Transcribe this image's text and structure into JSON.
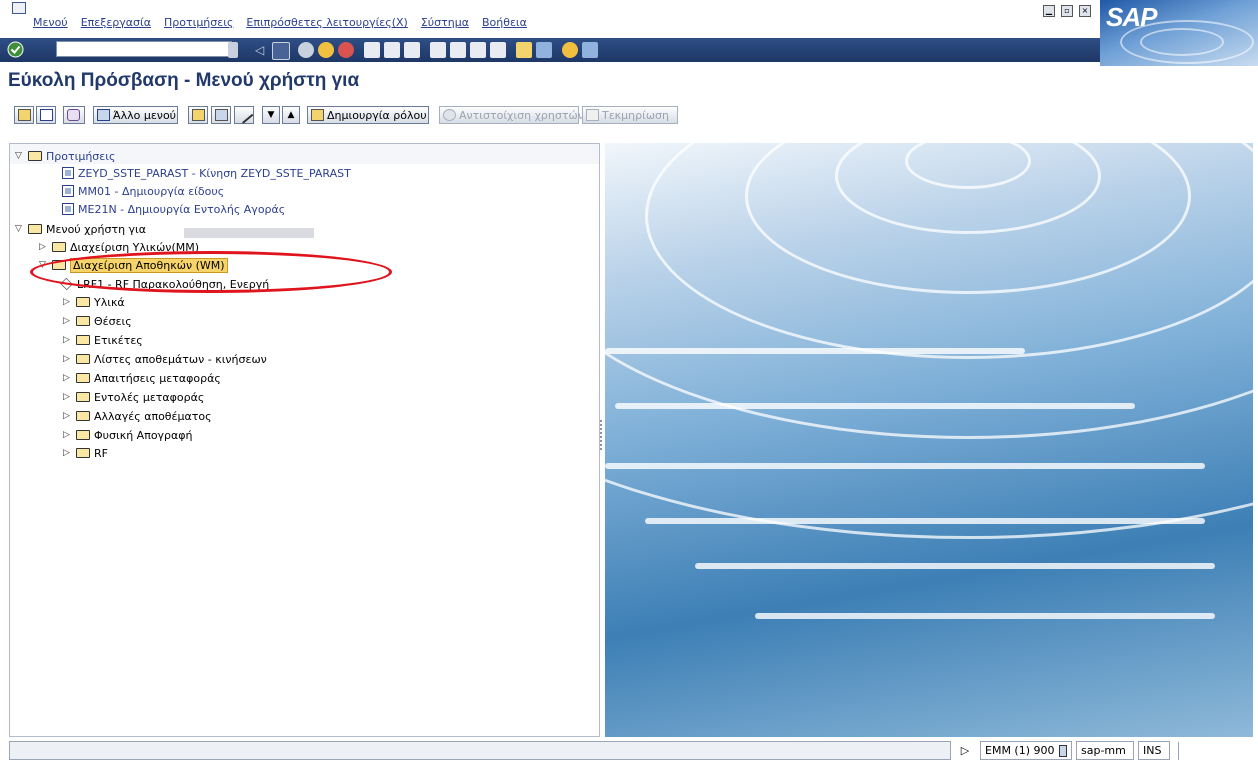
{
  "menubar": {
    "items": [
      "Μενού",
      "Επεξεργασία",
      "Προτιμήσεις",
      "Επιπρόσθετες λειτουργίες(X)",
      "Σύστημα",
      "Βοήθεια"
    ]
  },
  "logo": {
    "text": "SAP"
  },
  "command_field": {
    "value": ""
  },
  "page_title": "Εύκολη Πρόσβαση - Μενού χρήστη για",
  "app_toolbar": {
    "other_menu": "Άλλο μενού",
    "create_role": "Δημιουργία ρόλου",
    "assign_users": "Αντιστοίχιση χρηστών",
    "documentation": "Τεκμηρίωση"
  },
  "tree": {
    "favorites": "Προτιμήσεις",
    "fav_items": [
      "ZEYD_SSTE_PARAST - Κίνηση ZEYD_SSTE_PARAST",
      "MM01 - Δημιουργία είδους",
      "ME21N - Δημιουργία Εντολής Αγοράς"
    ],
    "user_menu": "Μενού χρήστη για",
    "mm": "Διαχείριση Υλικών(MM)",
    "wm": "Διαχείριση Αποθηκών (WM)",
    "lrf1": "LRF1 - RF Παρακολούθηση, Ενεργή",
    "wm_folders": [
      "Υλικά",
      "Θέσεις",
      "Ετικέτες",
      "Λίστες αποθεμάτων - κινήσεων",
      "Απαιτήσεις μεταφοράς",
      "Εντολές μεταφοράς",
      "Αλλαγές αποθέματος",
      "Φυσική Απογραφή",
      "RF"
    ]
  },
  "status": {
    "system": "EMM (1) 900",
    "server": "sap-mm",
    "mode": "INS"
  },
  "colors": {
    "highlight": "#f7d46a",
    "annotation": "#e0141d",
    "link": "#2b3f8f",
    "title": "#22396b"
  }
}
